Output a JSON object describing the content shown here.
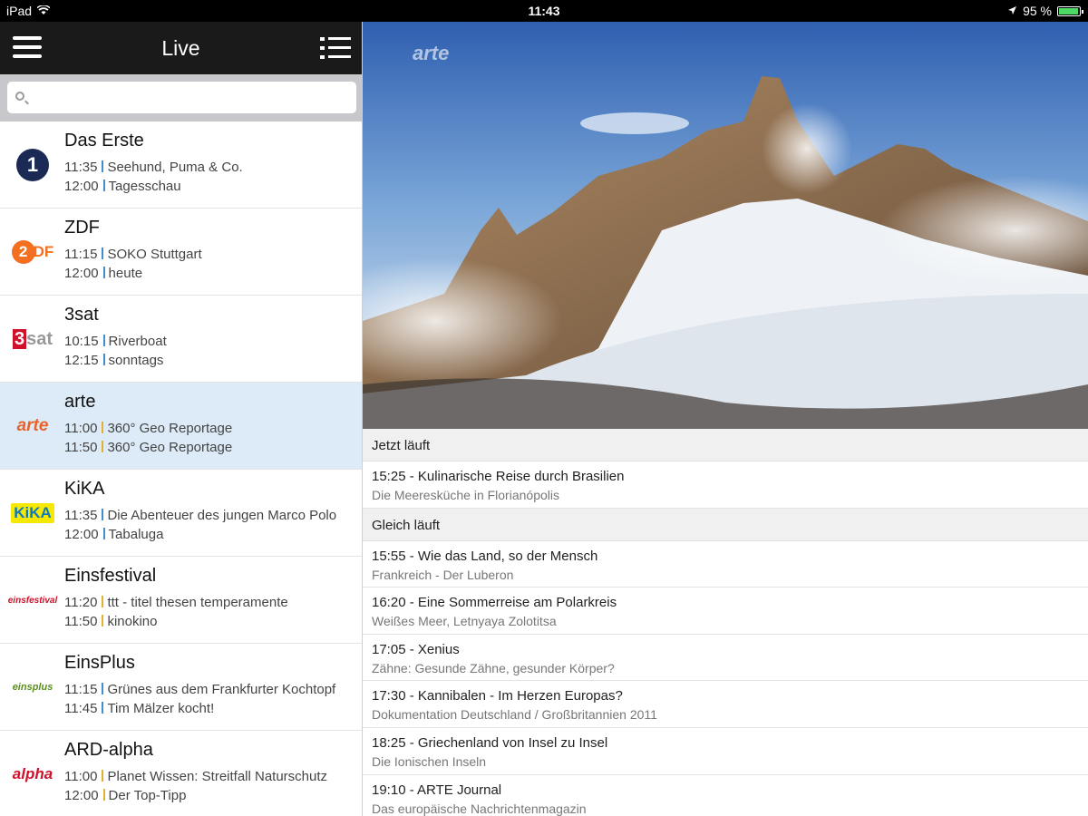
{
  "statusbar": {
    "device": "iPad",
    "time": "11:43",
    "battery": "95 %",
    "battery_level": 0.95
  },
  "navbar": {
    "title": "Live"
  },
  "search": {
    "placeholder": ""
  },
  "colors": {
    "sep_blue": "#3e8ed0",
    "sep_yellow": "#e1b32c",
    "selected_row": "#dcebf7",
    "arte_orange": "#e8632b"
  },
  "channels": [
    {
      "name": "Das Erste",
      "logo": "das-erste-logo",
      "p1_time": "11:35",
      "p1_title": "Seehund, Puma & Co.",
      "p2_time": "12:00",
      "p2_title": "Tagesschau"
    },
    {
      "name": "ZDF",
      "logo": "zdf-logo",
      "p1_time": "11:15",
      "p1_title": "SOKO Stuttgart",
      "p2_time": "12:00",
      "p2_title": "heute"
    },
    {
      "name": "3sat",
      "logo": "3sat-logo",
      "p1_time": "10:15",
      "p1_title": "Riverboat",
      "p2_time": "12:15",
      "p2_title": "sonntags"
    },
    {
      "name": "arte",
      "logo": "arte-logo",
      "p1_time": "11:00",
      "p1_title": "360° Geo Reportage",
      "p2_time": "11:50",
      "p2_title": "360° Geo Reportage"
    },
    {
      "name": "KiKA",
      "logo": "kika-logo",
      "p1_time": "11:35",
      "p1_title": "Die Abenteuer des jungen Marco Polo",
      "p2_time": "12:00",
      "p2_title": "Tabaluga"
    },
    {
      "name": "Einsfestival",
      "logo": "einsfestival-logo",
      "p1_time": "11:20",
      "p1_title": "ttt - titel thesen temperamente",
      "p2_time": "11:50",
      "p2_title": "kinokino"
    },
    {
      "name": "EinsPlus",
      "logo": "einsplus-logo",
      "p1_time": "11:15",
      "p1_title": "Grünes aus dem Frankfurter Kochtopf",
      "p2_time": "11:45",
      "p2_title": "Tim Mälzer kocht!"
    },
    {
      "name": "ARD-alpha",
      "logo": "ard-alpha-logo",
      "p1_time": "11:00",
      "p1_title": "Planet Wissen: Streitfall Naturschutz",
      "p2_time": "12:00",
      "p2_title": "Der Top-Tipp"
    }
  ],
  "logos": {
    "das_erste": "1",
    "zdf_o": "2",
    "zdf_t": "DF",
    "sat_n": "3",
    "sat_s": "sat",
    "arte": "arte",
    "kika": "KiKA",
    "eins": "einsfestival",
    "plus": "einsplus",
    "alpha": "alpha"
  },
  "player": {
    "watermark": "arte"
  },
  "now": {
    "header": "Jetzt läuft",
    "items": [
      {
        "title": "15:25 - Kulinarische Reise durch Brasilien",
        "subtitle": "Die Meeresküche in Florianópolis"
      }
    ]
  },
  "next": {
    "header": "Gleich läuft",
    "items": [
      {
        "title": "15:55 - Wie das Land, so der Mensch",
        "subtitle": "Frankreich - Der Luberon"
      },
      {
        "title": "16:20 - Eine Sommerreise am Polarkreis",
        "subtitle": "Weißes Meer, Letnyaya Zolotitsa"
      },
      {
        "title": "17:05 - Xenius",
        "subtitle": "Zähne: Gesunde Zähne, gesunder Körper?"
      },
      {
        "title": "17:30 - Kannibalen - Im Herzen Europas?",
        "subtitle": "Dokumentation Deutschland / Großbritannien 2011"
      },
      {
        "title": "18:25 - Griechenland von Insel zu Insel",
        "subtitle": "Die Ionischen Inseln"
      },
      {
        "title": "19:10 - ARTE Journal",
        "subtitle": "Das europäische Nachrichtenmagazin"
      }
    ]
  }
}
